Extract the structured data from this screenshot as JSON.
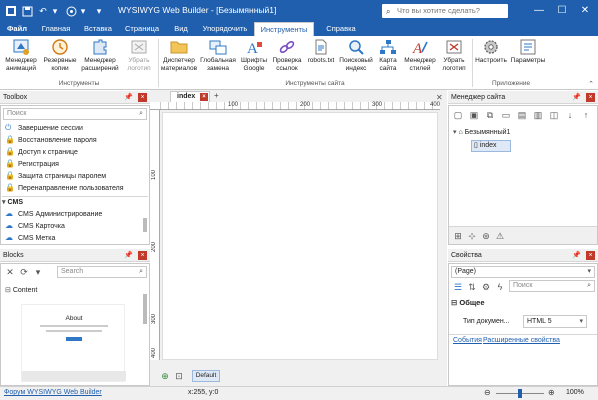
{
  "window": {
    "title": "WYSIWYG Web Builder - [Безымянный1]",
    "search_placeholder": "Что вы хотите сделать?",
    "minimize": "—",
    "maximize": "☐",
    "close": "✕"
  },
  "tabs": {
    "file": "Файл",
    "home": "Главная",
    "insert": "Вставка",
    "page": "Страница",
    "view": "Вид",
    "arrange": "Упорядочить",
    "tools": "Инструменты",
    "help": "Справка"
  },
  "ribbon": {
    "buttons": {
      "animation_manager": [
        "Менеджер",
        "анимаций"
      ],
      "backup": [
        "Резервные",
        "копии"
      ],
      "extension_manager": [
        "Менеджер",
        "расширений"
      ],
      "remove_logo": [
        "Убрать",
        "логотип"
      ],
      "material_manager": [
        "Диспетчер",
        "материалов"
      ],
      "global_replace": [
        "Глобальная",
        "замена"
      ],
      "google_fonts": [
        "Шрифты",
        "Google"
      ],
      "link_check": [
        "Проверка",
        "ссылок"
      ],
      "robots": [
        "robots.txt",
        ""
      ],
      "search_index": [
        "Поисковый",
        "индекс"
      ],
      "site_map": [
        "Карта",
        "сайта"
      ],
      "style_manager": [
        "Менеджер",
        "стилей"
      ],
      "remove_logo2": [
        "Убрать",
        "логотип"
      ],
      "settings": [
        "Настроить",
        ""
      ],
      "parameters": [
        "Параметры",
        ""
      ]
    },
    "groups": {
      "tools": "Инструменты",
      "site_tools": "Инструменты сайта",
      "application": "Приложение"
    }
  },
  "toolbox": {
    "title": "Toolbox",
    "search_placeholder": "Поиск",
    "items": [
      "Завершение сессии",
      "Восстановление пароля",
      "Доступ к странице",
      "Регистрация",
      "Защита страницы паролем",
      "Перенаправление пользователя"
    ],
    "cms_section": "CMS",
    "cms_items": [
      "CMS Администрирование",
      "CMS Карточка",
      "CMS Метка"
    ]
  },
  "blocks": {
    "title": "Blocks",
    "search_placeholder": "Search",
    "content_label": "Content",
    "preview_heading": "About"
  },
  "editor": {
    "tab_label": "index",
    "ruler_top": [
      "100",
      "200",
      "300",
      "400"
    ],
    "ruler_left": [
      "100",
      "200",
      "300",
      "400"
    ],
    "bottom_tab": "Default"
  },
  "site_manager": {
    "title": "Менеджер сайта",
    "root": "Безымянный1",
    "page": "index"
  },
  "properties": {
    "title": "Свойства",
    "selector": "(Page)",
    "search_placeholder": "Поиск",
    "section": "Общее",
    "row_label": "Тип докумен...",
    "row_value": "HTML 5",
    "link_events": "События",
    "link_advanced": "Расширенные свойства"
  },
  "status": {
    "forum_link": "Форум WYSIWYG Web Builder",
    "coords": "x:255, y:0",
    "zoom": "100%",
    "zoom_level": 0.5
  },
  "colors": {
    "accent": "#1f5fae",
    "close_red": "#c0392b"
  }
}
